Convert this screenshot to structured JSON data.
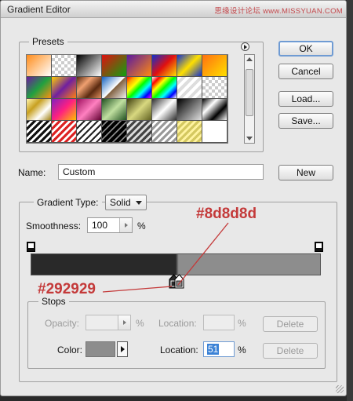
{
  "window": {
    "title": "Gradient Editor",
    "watermark": "思缘设计论坛 www.MISSYUAN.COM"
  },
  "presets": {
    "title": "Presets",
    "swatches": [
      "orange-white",
      "transparent-orange",
      "black-white",
      "red-green",
      "violet-orange",
      "blue-red-yellow",
      "blue-yellow-blue",
      "orange-yellow",
      "violet-green-orange",
      "yellow-violet-orange",
      "copper",
      "chrome",
      "spectrum",
      "transparent-rainbow",
      "transparent-stripes",
      "checker",
      "yellow-chrome",
      "violet-spectrum",
      "magenta-chrome",
      "green-chrome",
      "olive",
      "silver-steel",
      "black-silver",
      "metal-blue",
      "diagonal-black",
      "diagonal-red-white",
      "diagonal-white",
      "diagonal-dark",
      "diagonal-gray",
      "diagonal-silver",
      "diagonal-yellow",
      "blank"
    ]
  },
  "buttons": {
    "ok": "OK",
    "cancel": "Cancel",
    "load": "Load...",
    "save": "Save...",
    "new": "New"
  },
  "name": {
    "label": "Name:",
    "value": "Custom"
  },
  "gradient": {
    "type_label": "Gradient Type:",
    "type_value": "Solid",
    "smoothness_label": "Smoothness:",
    "smoothness_value": "100",
    "percent": "%",
    "left_color": "#292929",
    "right_color": "#8d8d8d",
    "midpoint_location": 51
  },
  "annotations": {
    "right_color": "#8d8d8d",
    "left_color": "#292929"
  },
  "stops": {
    "title": "Stops",
    "opacity_label": "Opacity:",
    "opacity_percent": "%",
    "location_label": "Location:",
    "location_percent": "%",
    "delete_label": "Delete",
    "color_label": "Color:",
    "color_location_label": "Location:",
    "color_location_value": "51",
    "color_location_percent": "%",
    "color_delete_label": "Delete"
  }
}
